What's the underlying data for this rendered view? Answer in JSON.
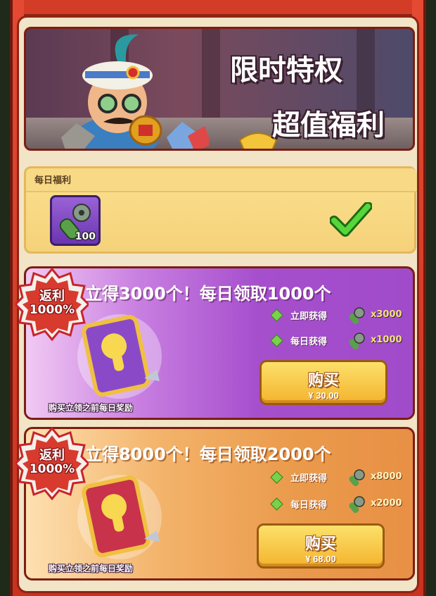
{
  "banner": {
    "title_line1": "限时特权",
    "title_line2": "超值福利"
  },
  "daily": {
    "title": "每日福利",
    "item_count": "100",
    "claimed_icon": "check-icon"
  },
  "offers": [
    {
      "badge_line1": "返利",
      "badge_line2": "1000%",
      "headline": "立得3000个！每日领取1000个",
      "rewards": [
        {
          "label": "立即获得",
          "qty": "x3000"
        },
        {
          "label": "每日获得",
          "qty": "x1000"
        }
      ],
      "buy_label": "购买",
      "price": "¥ 30.00",
      "caption": "购买立领之前每日奖励"
    },
    {
      "badge_line1": "返利",
      "badge_line2": "1000%",
      "headline": "立得8000个！每日领取2000个",
      "rewards": [
        {
          "label": "立即获得",
          "qty": "x8000"
        },
        {
          "label": "每日获得",
          "qty": "x2000"
        }
      ],
      "buy_label": "购买",
      "price": "¥ 68.00",
      "caption": "购买立领之前每日奖励"
    }
  ],
  "colors": {
    "frame_red": "#d33d28",
    "card_purple": "#a64fcd",
    "card_orange": "#ea9a4b",
    "button_yellow": "#f4b32e",
    "check_green": "#3fbf2a"
  }
}
